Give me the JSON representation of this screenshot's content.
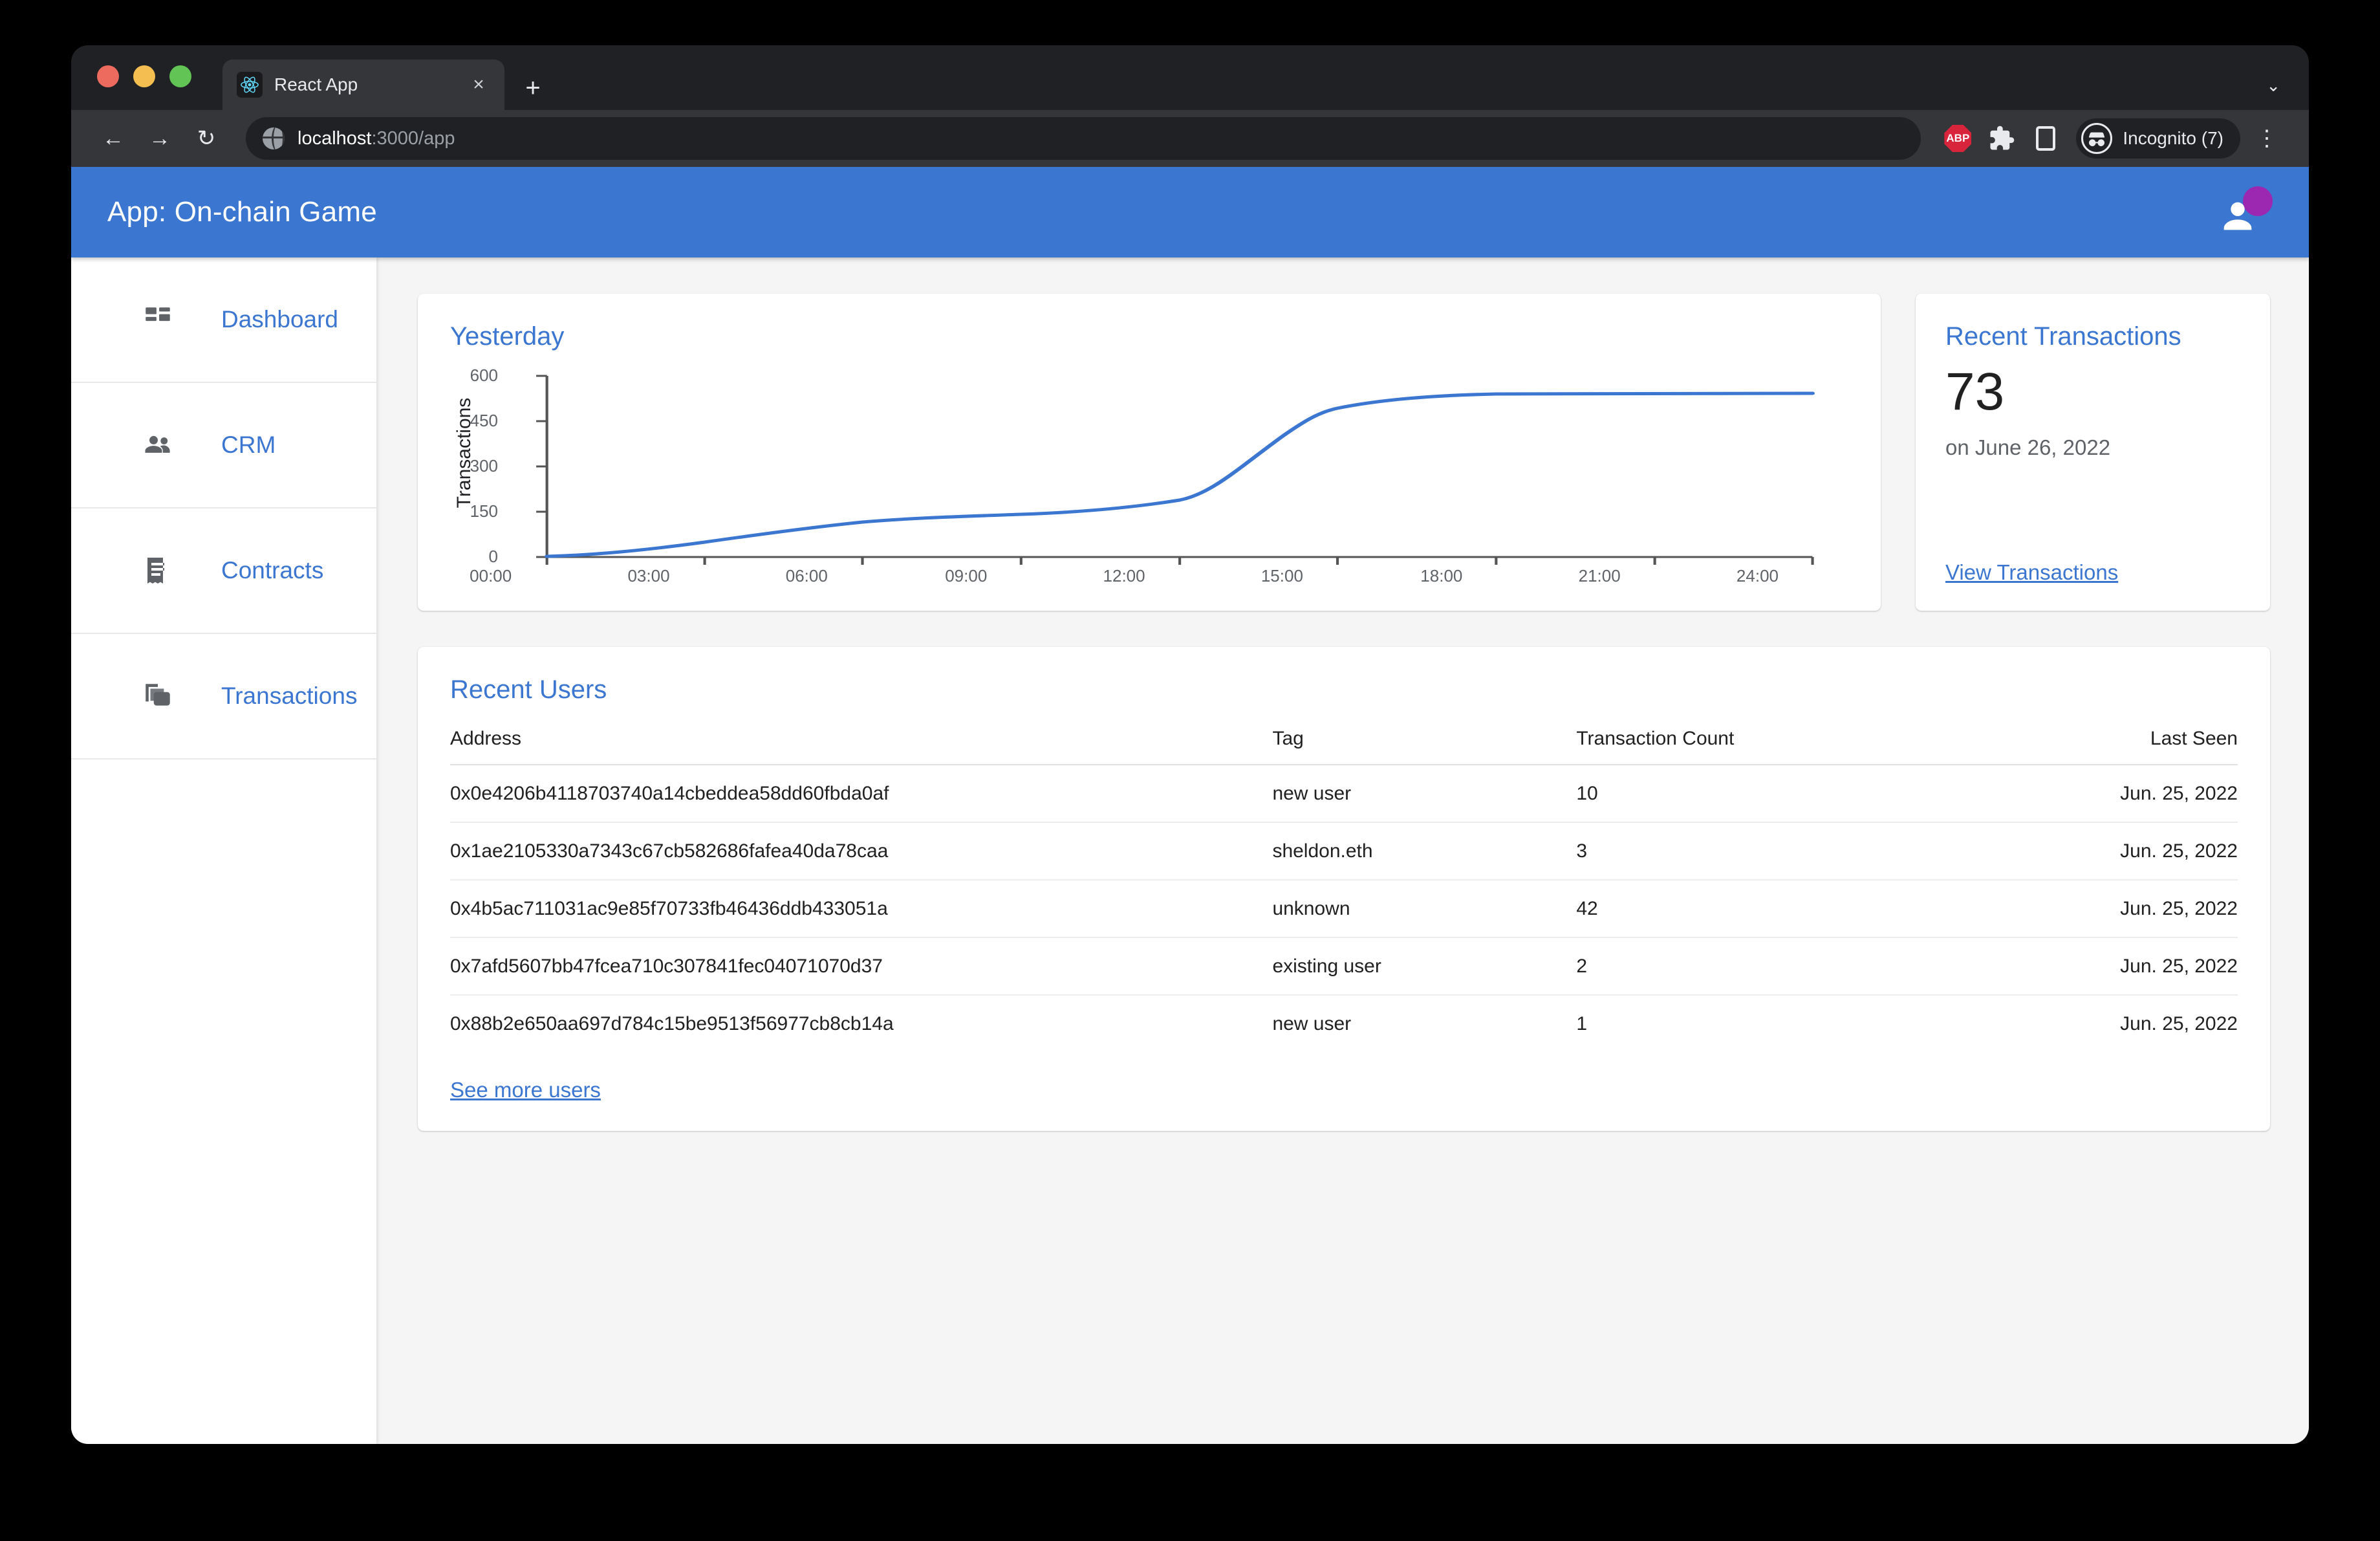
{
  "browser": {
    "tab": {
      "title": "React App",
      "favicon": "react-icon",
      "close": "×"
    },
    "new_tab": "+",
    "tab_list_chevron": "⌄",
    "nav": {
      "back": "←",
      "forward": "→",
      "reload": "↻"
    },
    "omnibox": {
      "host": "localhost",
      "path": ":3000/app",
      "icon": "globe-icon"
    },
    "extensions": {
      "adblock_label": "ABP",
      "puzzle": "puzzle-icon",
      "sidepanel": "side-panel-icon"
    },
    "profile": {
      "label": "Incognito (7)",
      "icon": "incognito-icon"
    },
    "menu": "⋮"
  },
  "app": {
    "title": "App: On-chain Game",
    "accent": "#3b76d0",
    "avatar_badge_color": "#9c27b0"
  },
  "sidebar": {
    "items": [
      {
        "label": "Dashboard",
        "icon": "dashboard-icon"
      },
      {
        "label": "CRM",
        "icon": "people-icon"
      },
      {
        "label": "Contracts",
        "icon": "receipt-icon"
      },
      {
        "label": "Transactions",
        "icon": "copy-icon"
      }
    ]
  },
  "chart_card": {
    "title": "Yesterday"
  },
  "chart_data": {
    "type": "line",
    "title": "Yesterday",
    "xlabel": "",
    "ylabel": "Transactions",
    "ylim": [
      0,
      600
    ],
    "yticks": [
      0,
      150,
      300,
      450,
      600
    ],
    "xticks": [
      "00:00",
      "03:00",
      "06:00",
      "09:00",
      "12:00",
      "15:00",
      "18:00",
      "21:00",
      "24:00"
    ],
    "xlim": [
      "00:00",
      "24:00"
    ],
    "grid": false,
    "legend": false,
    "line_color": "#3b76d0",
    "series": [
      {
        "name": "Transactions",
        "x": [
          "00:00",
          "01:00",
          "02:00",
          "03:00",
          "04:00",
          "05:00",
          "06:00",
          "07:00",
          "08:00",
          "09:00",
          "10:00",
          "11:00",
          "12:00",
          "13:00",
          "14:00",
          "15:00",
          "16:00",
          "17:00",
          "18:00",
          "19:00",
          "20:00",
          "21:00"
        ],
        "values": [
          2,
          6,
          14,
          25,
          38,
          50,
          60,
          64,
          67,
          72,
          80,
          95,
          150,
          280,
          410,
          450,
          480,
          495,
          500,
          500,
          500,
          500
        ]
      }
    ]
  },
  "transactions_card": {
    "title": "Recent Transactions",
    "count": "73",
    "subtitle": "on June 26, 2022",
    "link": "View Transactions"
  },
  "users_card": {
    "title": "Recent Users",
    "columns": [
      "Address",
      "Tag",
      "Transaction Count",
      "Last Seen"
    ],
    "rows": [
      {
        "address": "0x0e4206b4118703740a14cbeddea58dd60fbda0af",
        "tag": "new user",
        "count": "10",
        "last_seen": "Jun. 25, 2022"
      },
      {
        "address": "0x1ae2105330a7343c67cb582686fafea40da78caa",
        "tag": "sheldon.eth",
        "count": "3",
        "last_seen": "Jun. 25, 2022"
      },
      {
        "address": "0x4b5ac711031ac9e85f70733fb46436ddb433051a",
        "tag": "unknown",
        "count": "42",
        "last_seen": "Jun. 25, 2022"
      },
      {
        "address": "0x7afd5607bb47fcea710c307841fec04071070d37",
        "tag": "existing user",
        "count": "2",
        "last_seen": "Jun. 25, 2022"
      },
      {
        "address": "0x88b2e650aa697d784c15be9513f56977cb8cb14a",
        "tag": "new user",
        "count": "1",
        "last_seen": "Jun. 25, 2022"
      }
    ],
    "more_link": "See more users"
  }
}
